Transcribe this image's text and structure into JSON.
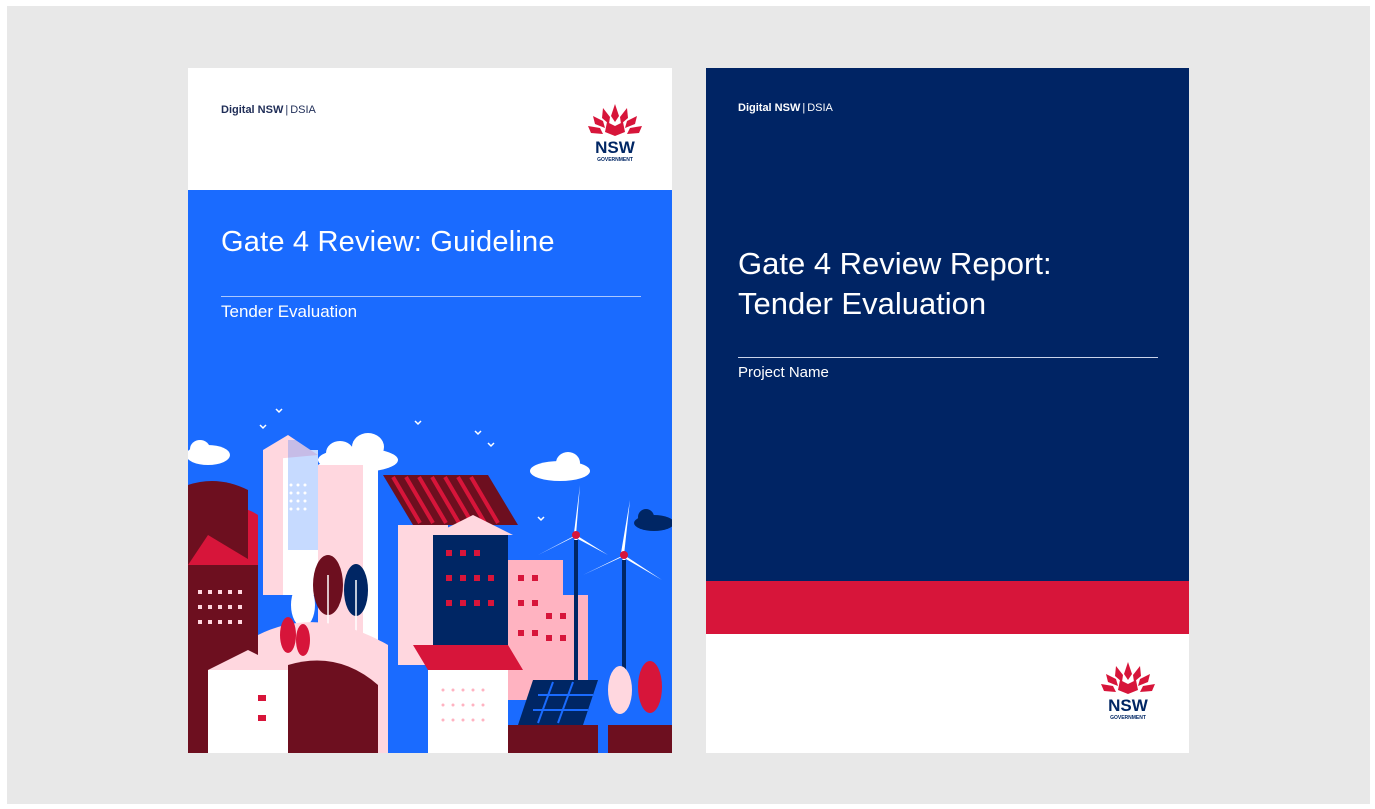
{
  "left_cover": {
    "org_strong": "Digital NSW",
    "org_sep": "|",
    "org_rest": "DSIA",
    "title": "Gate 4 Review: Guideline",
    "subtitle": "Tender Evaluation",
    "logo": {
      "name": "NSW",
      "sub": "GOVERNMENT"
    }
  },
  "right_cover": {
    "org_strong": "Digital NSW",
    "org_sep": "|",
    "org_rest": "DSIA",
    "title_line1": "Gate 4 Review Report:",
    "title_line2": "Tender Evaluation",
    "subtitle": "Project Name",
    "logo": {
      "name": "NSW",
      "sub": "GOVERNMENT"
    }
  },
  "colors": {
    "background": "#e8e8e8",
    "guideline_blue": "#1a6bff",
    "report_navy": "#002464",
    "nsw_red": "#d7153a",
    "nsw_navy": "#002664"
  }
}
